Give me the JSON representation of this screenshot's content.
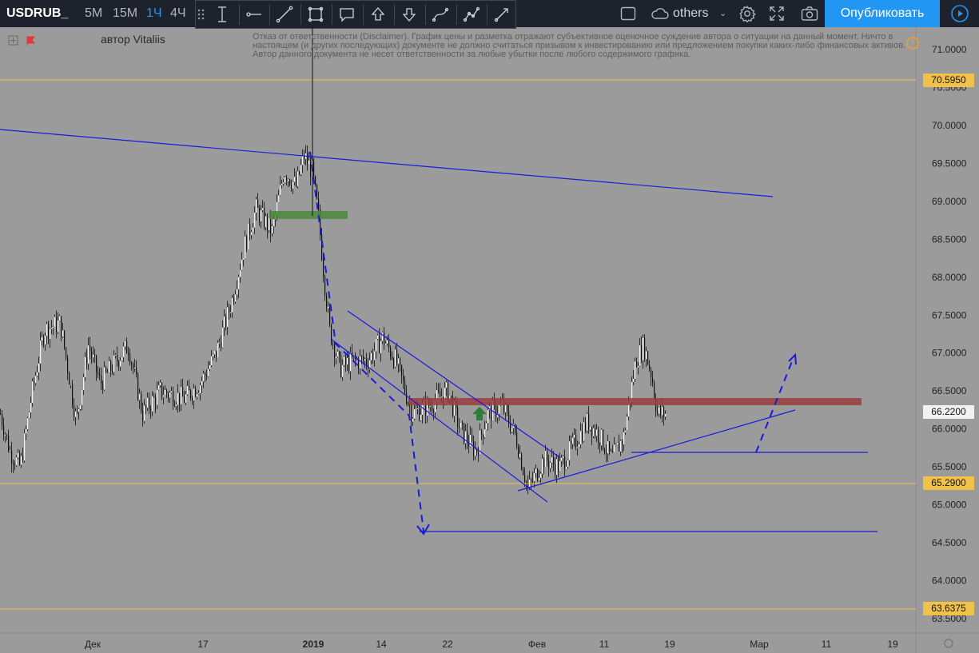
{
  "toolbar": {
    "symbol": "USDRUB_",
    "intervals": [
      "5M",
      "15M",
      "1Ч",
      "4Ч"
    ],
    "active_interval": "1Ч",
    "others_label": "others",
    "publish_label": "Опубликовать"
  },
  "header": {
    "author": "автор Vitaliis",
    "disclaimer": "Отказ от ответственности (Disclaimer). График цены и разметка отражают субъективное оценочное суждение автора о ситуации на данный момент. Ничто в настоящем (и других последующих) документе не должно считаться призывом к инвестированию или предложением покупки каких-либо финансовых активов. Автор данного документа не несет ответственности за любые убытки после любого содержимого графика."
  },
  "price_axis": {
    "ticks": [
      "71.0000",
      "70.5000",
      "70.0000",
      "69.5000",
      "69.0000",
      "68.5000",
      "68.0000",
      "67.5000",
      "67.0000",
      "66.5000",
      "66.0000",
      "65.5000",
      "65.0000",
      "64.5000",
      "64.0000",
      "63.5000"
    ],
    "tick_values": [
      71.0,
      70.5,
      70.0,
      69.5,
      69.0,
      68.5,
      68.0,
      67.5,
      67.0,
      66.5,
      66.0,
      65.5,
      65.0,
      64.5,
      64.0,
      63.5
    ],
    "tags": {
      "level_high": "70.5950",
      "current": "66.2200",
      "level_mid": "65.2900",
      "level_low": "63.6375"
    }
  },
  "time_axis": {
    "labels": [
      "Дек",
      "17",
      "2019",
      "14",
      "22",
      "Фев",
      "11",
      "19",
      "Мар",
      "11",
      "19"
    ]
  },
  "chart_data": {
    "type": "candlestick",
    "symbol": "USDRUB_",
    "timeframe": "1Ч",
    "y_range": [
      63.4,
      71.5
    ],
    "horizontal_levels": [
      70.595,
      65.29,
      63.6375
    ],
    "current_price": 66.22,
    "resistance_zone": 66.38,
    "support_zone": 68.82
  },
  "colors": {
    "background": "#9b9b9b",
    "level_line": "#f0c24a",
    "trend_line": "#1a1adb",
    "resistance": "#9b3d3d",
    "support": "#4a8a3a",
    "accent": "#2196f3"
  }
}
